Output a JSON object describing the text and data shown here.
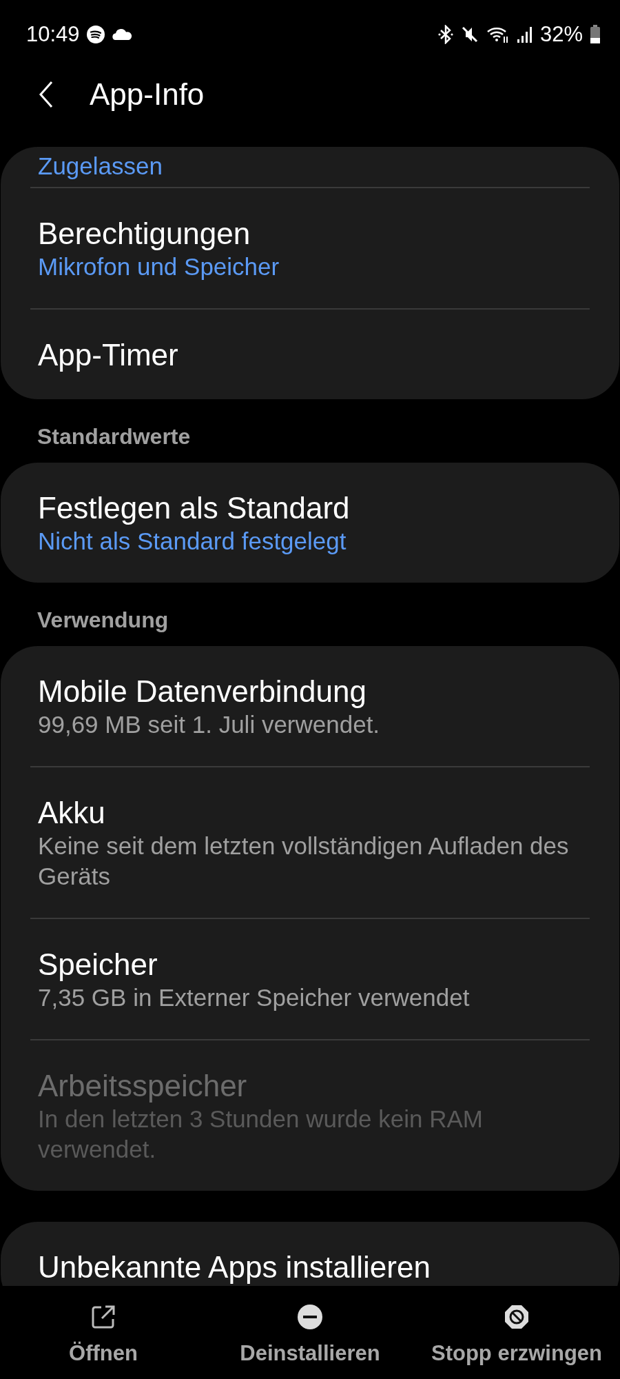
{
  "status_bar": {
    "time": "10:49",
    "battery": "32%"
  },
  "header": {
    "title": "App-Info"
  },
  "cards": [
    {
      "items": [
        {
          "subtitle": "Zugelassen",
          "accent": true
        },
        {
          "title": "Berechtigungen",
          "subtitle": "Mikrofon und Speicher",
          "accent": true,
          "disabled": false
        },
        {
          "title": "App-Timer",
          "disabled": false
        }
      ]
    },
    {
      "heading": "Standardwerte",
      "items": [
        {
          "title": "Festlegen als Standard",
          "subtitle": "Nicht als Standard festgelegt",
          "accent": true,
          "disabled": false
        }
      ]
    },
    {
      "heading": "Verwendung",
      "items": [
        {
          "title": "Mobile Datenverbindung",
          "subtitle": "99,69 MB seit 1. Juli verwendet.",
          "accent": false,
          "disabled": false
        },
        {
          "title": "Akku",
          "subtitle": "Keine seit dem letzten vollständigen Aufladen des Geräts",
          "accent": false,
          "disabled": false
        },
        {
          "title": "Speicher",
          "subtitle": "7,35 GB in Externer Speicher verwendet",
          "accent": false,
          "disabled": false
        },
        {
          "title": "Arbeitsspeicher",
          "subtitle": "In den letzten 3 Stunden wurde kein RAM verwendet.",
          "accent": false,
          "disabled": true
        }
      ]
    },
    {
      "items": [
        {
          "title": "Unbekannte Apps installieren",
          "disabled": false
        }
      ]
    }
  ],
  "actions": [
    {
      "kind": "open",
      "label": "Öffnen"
    },
    {
      "kind": "uninstall",
      "label": "Deinstallieren"
    },
    {
      "kind": "stop",
      "label": "Stopp erzwingen"
    }
  ]
}
